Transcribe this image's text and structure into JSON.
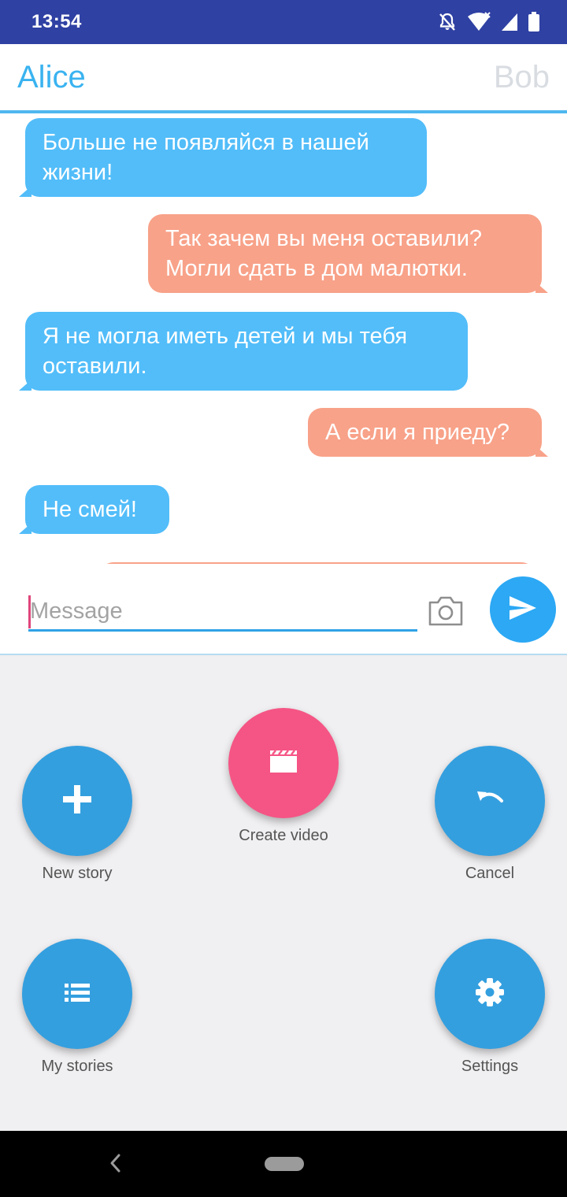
{
  "status_bar": {
    "time": "13:54"
  },
  "header": {
    "left_name": "Alice",
    "right_name": "Bob"
  },
  "messages": [
    {
      "side": "in",
      "text": "Больше не появляйся в нашей\nжизни!"
    },
    {
      "side": "out",
      "text": "Так зачем вы меня оставили?\nМогли сдать в дом малютки."
    },
    {
      "side": "in",
      "text": "Я не могла иметь детей и мы тебя\nоставили."
    },
    {
      "side": "out",
      "text": "А если я приеду?"
    },
    {
      "side": "in",
      "text": "Не смей!"
    }
  ],
  "composer": {
    "placeholder": "Message",
    "camera_icon": "camera-icon",
    "send_icon": "send-icon"
  },
  "fab_menu": {
    "create_video": {
      "label": "Create video",
      "icon": "movie-clapper-icon"
    },
    "new_story": {
      "label": "New story",
      "icon": "plus-icon"
    },
    "cancel": {
      "label": "Cancel",
      "icon": "undo-icon"
    },
    "my_stories": {
      "label": "My stories",
      "icon": "list-icon"
    },
    "settings": {
      "label": "Settings",
      "icon": "gear-icon"
    }
  },
  "colors": {
    "status_bar": "#2f41a3",
    "accent": "#3ab3f0",
    "incoming_bubble": "#52bdf9",
    "outgoing_bubble": "#f8a289",
    "fab": "#349fdf",
    "fab_highlight": "#f55585"
  }
}
